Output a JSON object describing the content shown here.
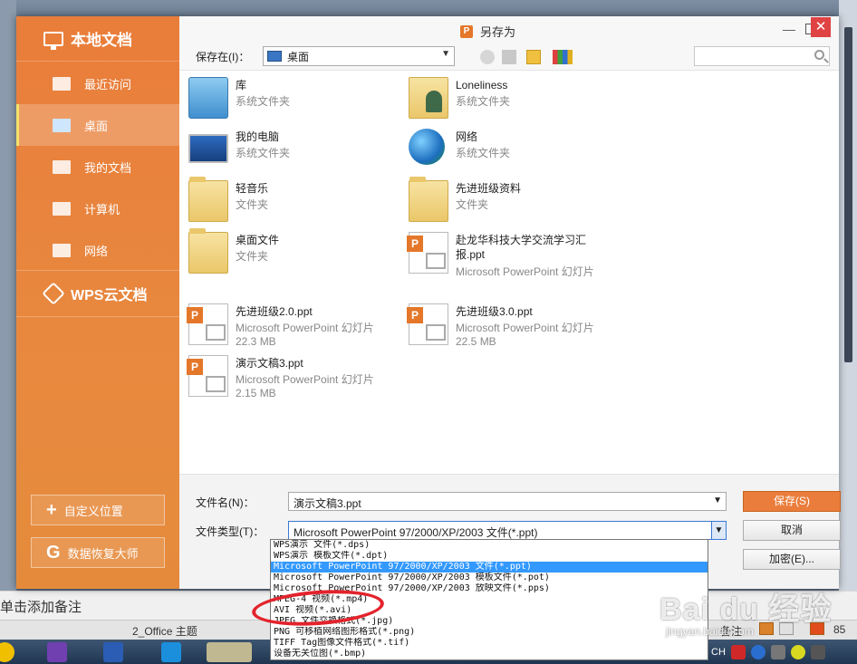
{
  "dialog": {
    "title": "另存为",
    "close": "✕",
    "minimize": "—"
  },
  "sidebar": {
    "header": "本地文档",
    "items": [
      {
        "label": "最近访问"
      },
      {
        "label": "桌面"
      },
      {
        "label": "我的文档"
      },
      {
        "label": "计算机"
      },
      {
        "label": "网络"
      }
    ],
    "cloud": "WPS云文档",
    "custom_location": "自定义位置",
    "data_recovery": "数据恢复大师"
  },
  "toolbar": {
    "save_in_label": "保存在(I)：",
    "save_in_value": "桌面"
  },
  "files": [
    {
      "name": "库",
      "sub1": "系统文件夹",
      "sub2": "",
      "icon": "library-icon"
    },
    {
      "name": "Loneliness",
      "sub1": "系统文件夹",
      "sub2": "",
      "icon": "user-folder-icon"
    },
    {
      "name": "我的电脑",
      "sub1": "系统文件夹",
      "sub2": "",
      "icon": "computer-icon"
    },
    {
      "name": "网络",
      "sub1": "系统文件夹",
      "sub2": "",
      "icon": "network-globe-icon"
    },
    {
      "name": "轻音乐",
      "sub1": "文件夹",
      "sub2": "",
      "icon": "folder-icon"
    },
    {
      "name": "先进班级资料",
      "sub1": "文件夹",
      "sub2": "",
      "icon": "folder-icon"
    },
    {
      "name": "桌面文件",
      "sub1": "文件夹",
      "sub2": "",
      "icon": "folder-icon"
    },
    {
      "name": "赴龙华科技大学交流学习汇报.ppt",
      "sub1": "Microsoft PowerPoint 幻灯片",
      "sub2": "",
      "icon": "ppt-file-icon"
    },
    {
      "name": "先进班级2.0.ppt",
      "sub1": "Microsoft PowerPoint 幻灯片",
      "sub2": "22.3 MB",
      "icon": "ppt-file-icon"
    },
    {
      "name": "先进班级3.0.ppt",
      "sub1": "Microsoft PowerPoint 幻灯片",
      "sub2": "22.5 MB",
      "icon": "ppt-file-icon"
    },
    {
      "name": "演示文稿3.ppt",
      "sub1": "Microsoft PowerPoint 幻灯片",
      "sub2": "2.15 MB",
      "icon": "ppt-file-icon"
    }
  ],
  "form": {
    "filename_label": "文件名(N)：",
    "filename_value": "演示文稿3.ppt",
    "filetype_label": "文件类型(T)：",
    "filetype_value": "Microsoft PowerPoint 97/2000/XP/2003 文件(*.ppt)",
    "save": "保存(S)",
    "cancel": "取消",
    "encrypt": "加密(E)..."
  },
  "filetype_options": [
    "WPS演示 文件(*.dps)",
    "WPS演示 模板文件(*.dpt)",
    "Microsoft PowerPoint 97/2000/XP/2003 文件(*.ppt)",
    "Microsoft PowerPoint 97/2000/XP/2003 模板文件(*.pot)",
    "Microsoft PowerPoint 97/2000/XP/2003 放映文件(*.pps)",
    "MPEG-4 视频(*.mp4)",
    "AVI 视频(*.avi)",
    "JPEG 文件交换格式(*.jpg)",
    "PNG 可移植网络图形格式(*.png)",
    "TIFF Tag图像文件格式(*.tif)",
    "设备无关位图(*.bmp)"
  ],
  "selected_option_index": 2,
  "background": {
    "note_placeholder": "单击添加备注",
    "theme": "2_Office 主题",
    "note_btn": "备注",
    "zoom": "85",
    "ime": "CH"
  },
  "watermark": {
    "brand": "Bai du 经验",
    "url": "jingyan.baidu.com"
  },
  "colors": {
    "accent": "#e8843c",
    "selection": "#3399ff",
    "highlight_circle": "#e3232c"
  }
}
